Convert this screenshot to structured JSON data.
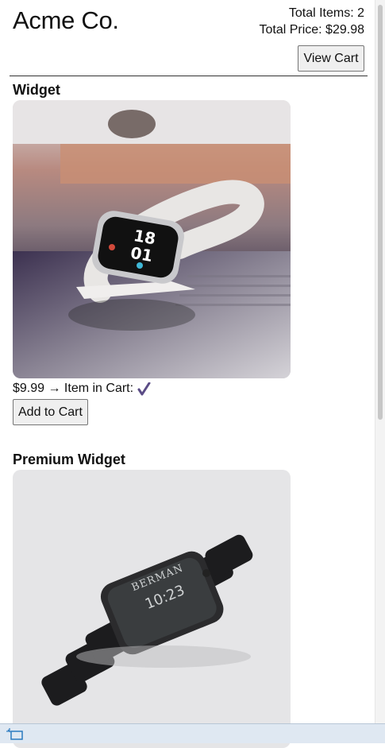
{
  "header": {
    "brand": "Acme Co.",
    "total_items": "Total Items: 2",
    "total_price": "Total Price: $29.98",
    "view_cart_label": "View Cart"
  },
  "products": [
    {
      "name": "Widget",
      "image_alt": "white smartwatch",
      "price_line": "$9.99 → Item in Cart:",
      "in_cart_icon": "checkmark-icon",
      "add_label": "Add to Cart"
    },
    {
      "name": "Premium Widget",
      "image_alt": "black smartwatch",
      "watch_brand": "BERMAN",
      "watch_time": "10:23"
    }
  ],
  "colors": {
    "check": "#5b4c86",
    "rule": "#333333",
    "button_bg": "#efefef"
  }
}
